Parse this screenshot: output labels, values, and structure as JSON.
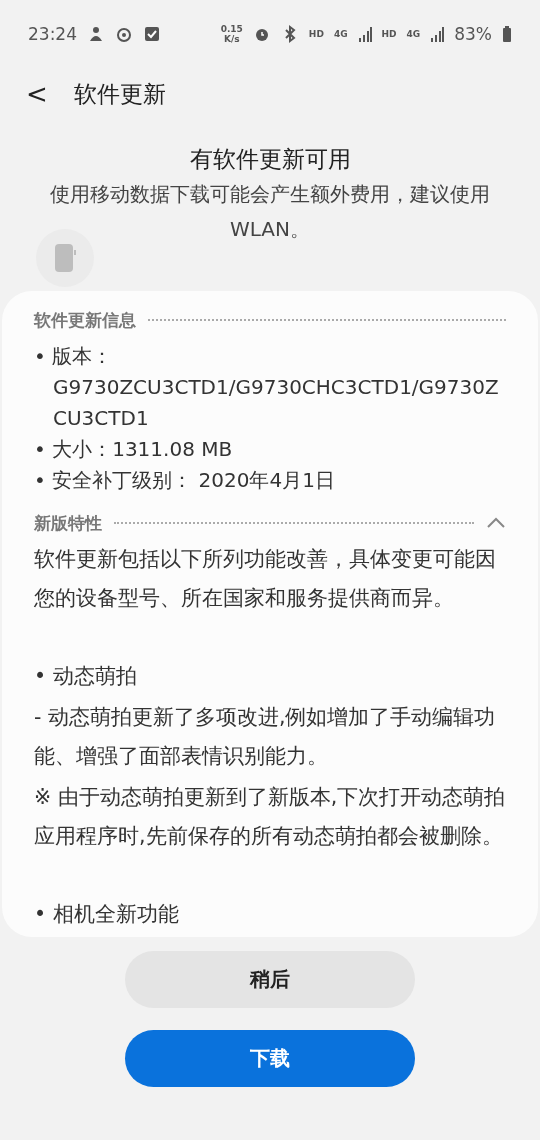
{
  "status_bar": {
    "time": "23:24",
    "speed_value": "0.15",
    "speed_unit": "K/s",
    "network_labels": [
      "HD",
      "4G",
      "HD",
      "4G"
    ],
    "battery": "83%"
  },
  "header": {
    "back": "<",
    "title": "软件更新"
  },
  "notice": {
    "title": "有软件更新可用",
    "message": "使用移动数据下载可能会产生额外费用，建议使用 WLAN。"
  },
  "info_section": {
    "title": "软件更新信息",
    "items": [
      {
        "label": "• 版本：",
        "value": "G9730ZCU3CTD1/G9730CHC3CTD1/G9730ZCU3CTD1"
      },
      {
        "label": "• 大小：",
        "value": "1311.08 MB"
      },
      {
        "label": "• 安全补丁级别：",
        "value": " 2020年4月1日"
      }
    ]
  },
  "features_section": {
    "title": "新版特性",
    "expanded": true,
    "lines": [
      {
        "kind": "paragraph",
        "text": "软件更新包括以下所列功能改善，具体变更可能因您的设备型号、所在国家和服务提供商而异。"
      },
      {
        "kind": "bullet",
        "text": "• 动态萌拍"
      },
      {
        "kind": "continued",
        "text": "- 动态萌拍更新了多项改进,例如增加了手动编辑功能、增强了面部表情识别能力。"
      },
      {
        "kind": "paragraph",
        "text": "※ 由于动态萌拍更新到了新版本,下次打开动态萌拍应用程序时,先前保存的所有动态萌拍都会被删除。"
      },
      {
        "kind": "bullet",
        "text": "• 相机全新功能"
      }
    ]
  },
  "buttons": [
    {
      "label": "稍后",
      "kind": "secondary"
    },
    {
      "label": "下载",
      "kind": "primary"
    }
  ]
}
